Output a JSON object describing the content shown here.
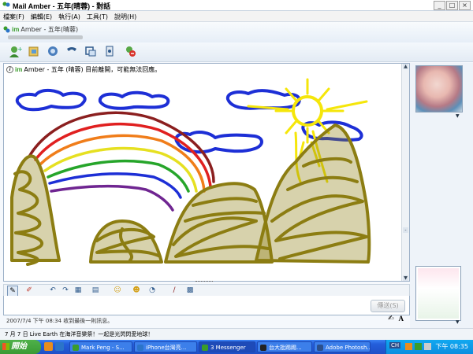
{
  "window": {
    "title": "Mail Amber - 五年(晴蓉) - 對話",
    "controls": {
      "minimize": "_",
      "maximize": "□",
      "close": "×"
    }
  },
  "menu": [
    "檔案(F)",
    "編輯(E)",
    "執行(A)",
    "工具(T)",
    "說明(H)"
  ],
  "contact": {
    "logo": "im",
    "name": "Amber - 五年(晴蓉)"
  },
  "toolbar": {
    "icons": [
      "invite-icon",
      "share-files-icon",
      "video-call-icon",
      "call-icon",
      "activities-icon",
      "games-icon",
      "block-icon"
    ]
  },
  "chat": {
    "info_logo": "im",
    "info_text": "Amber - 五年 (晴蓉) 目前離開，可能無法回應。"
  },
  "input": {
    "send_label": "傳送(S)"
  },
  "status": {
    "last_message": "2007/7/4 下午 08:34 收到最後一則訊息。",
    "personal_message": "7 月 7 日 Live Earth 在海洋音樂祭！一起是光閃閃愛地球！"
  },
  "colors": {
    "accent_green": "#3a9c2b",
    "taskbar_blue": "#245edb",
    "start_green": "#3a9a35"
  },
  "taskbar": {
    "start_label": "開始",
    "tasks": [
      {
        "label": "Mark Peng - S...",
        "active": false
      },
      {
        "label": "iPhone台灣亮...",
        "active": false
      },
      {
        "label": "3 Messenger",
        "active": true
      },
      {
        "label": "台大批踢踢...",
        "active": false
      },
      {
        "label": "Adobe Photosh...",
        "active": false
      }
    ],
    "lang": "CH",
    "clock": "下午 08:35"
  }
}
